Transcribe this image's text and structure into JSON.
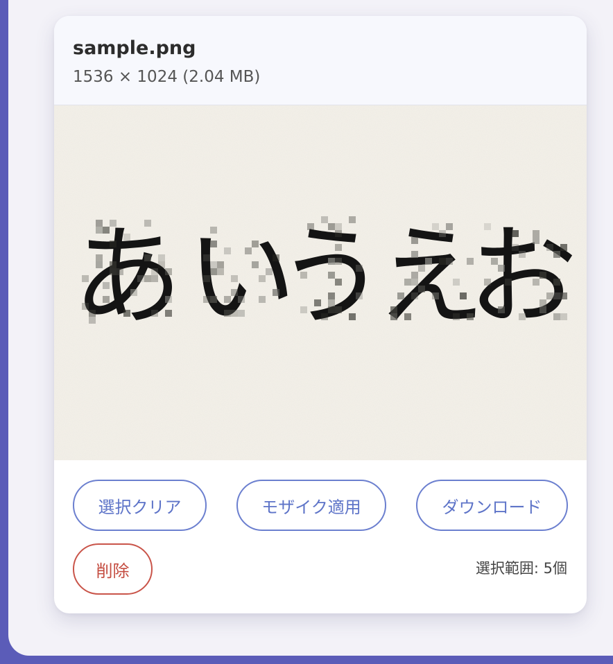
{
  "card": {
    "filename": "sample.png",
    "meta": "1536 × 1024 (2.04 MB)"
  },
  "preview": {
    "characters": [
      "あ",
      "い",
      "う",
      "え",
      "お"
    ],
    "mosaic_regions": 5
  },
  "actions": {
    "clear_label": "選択クリア",
    "mosaic_label": "モザイク適用",
    "download_label": "ダウンロード",
    "delete_label": "削除",
    "selection_info": "選択範囲: 5個"
  },
  "colors": {
    "frame": "#5b5cb8",
    "panel": "#f3f2f8",
    "accent": "#6b7fcf",
    "danger": "#c95449",
    "paper": "#f4f1ea",
    "ink": "#141414"
  }
}
